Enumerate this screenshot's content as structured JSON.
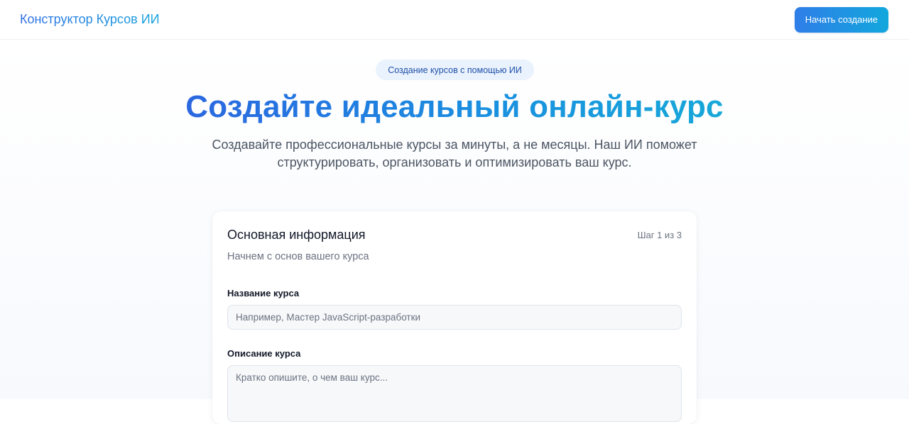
{
  "header": {
    "brand": "Конструктор Курсов ИИ",
    "start_button": "Начать создание"
  },
  "hero": {
    "badge": "Создание курсов с помощью ИИ",
    "title": "Создайте идеальный онлайн-курс",
    "subtitle_line1": "Создавайте профессиональные курсы за минуты, а не месяцы. Наш ИИ поможет",
    "subtitle_line2": "структурировать, организовать и оптимизировать ваш курс."
  },
  "form": {
    "title": "Основная информация",
    "step": "Шаг 1 из 3",
    "description": "Начнем с основ вашего курса",
    "course_name": {
      "label": "Название курса",
      "value": "",
      "placeholder": "Например, Мастер JavaScript-разработки"
    },
    "course_description": {
      "label": "Описание курса",
      "value": "",
      "placeholder": "Кратко опишите, о чем ваш курс..."
    }
  },
  "colors": {
    "accent_start": "#2f6fe4",
    "accent_end": "#14a3dc",
    "badge_bg": "#eaf2fd",
    "badge_text": "#1e4fa8"
  }
}
